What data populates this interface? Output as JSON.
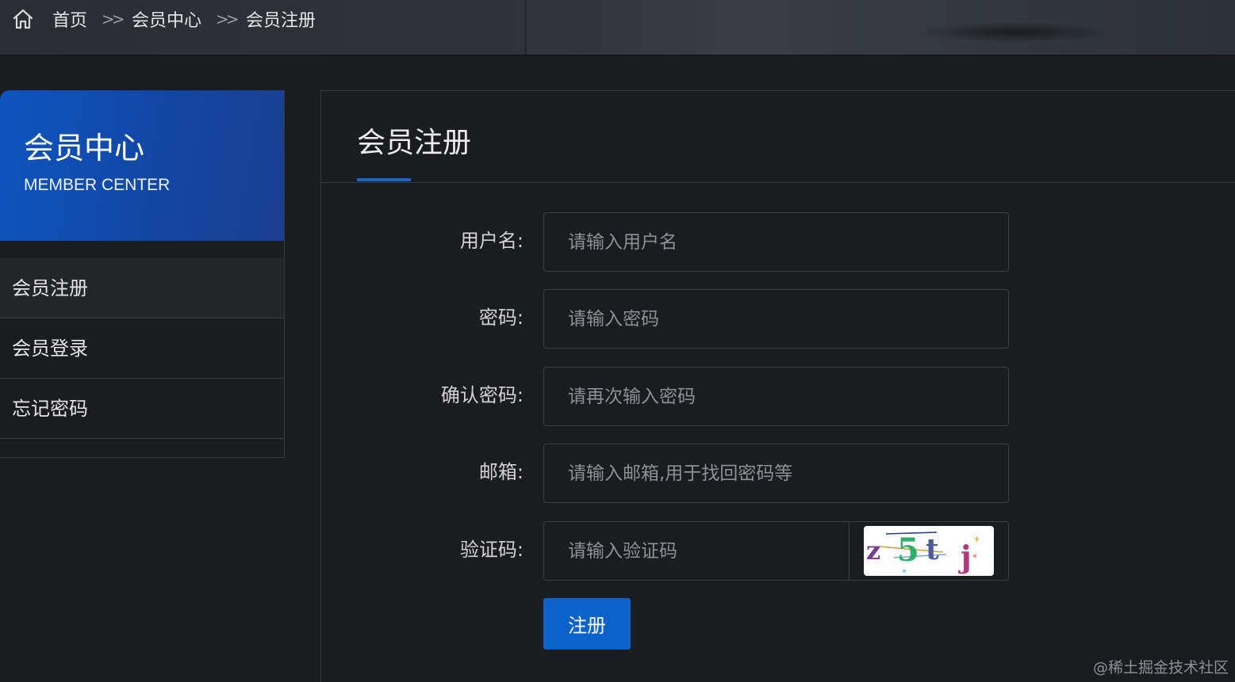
{
  "breadcrumb": {
    "items": [
      "首页",
      "会员中心",
      "会员注册"
    ],
    "separator": ">>"
  },
  "sidebar": {
    "title": "会员中心",
    "subtitle": "MEMBER CENTER",
    "items": [
      {
        "label": "会员注册",
        "active": true
      },
      {
        "label": "会员登录",
        "active": false
      },
      {
        "label": "忘记密码",
        "active": false
      }
    ]
  },
  "panel": {
    "title": "会员注册"
  },
  "form": {
    "username": {
      "label": "用户名:",
      "placeholder": "请输入用户名",
      "value": ""
    },
    "password": {
      "label": "密码:",
      "placeholder": "请输入密码",
      "value": ""
    },
    "confirm_password": {
      "label": "确认密码:",
      "placeholder": "请再次输入密码",
      "value": ""
    },
    "email": {
      "label": "邮箱:",
      "placeholder": "请输入邮箱,用于找回密码等",
      "value": ""
    },
    "captcha": {
      "label": "验证码:",
      "placeholder": "请输入验证码",
      "value": "",
      "image_text": "z5tj"
    },
    "submit_label": "注册"
  },
  "watermark": "@稀土掘金技术社区",
  "colors": {
    "accent": "#0b62c8",
    "background": "#1b1c1f",
    "sidebar_header": "#0d55bf"
  }
}
